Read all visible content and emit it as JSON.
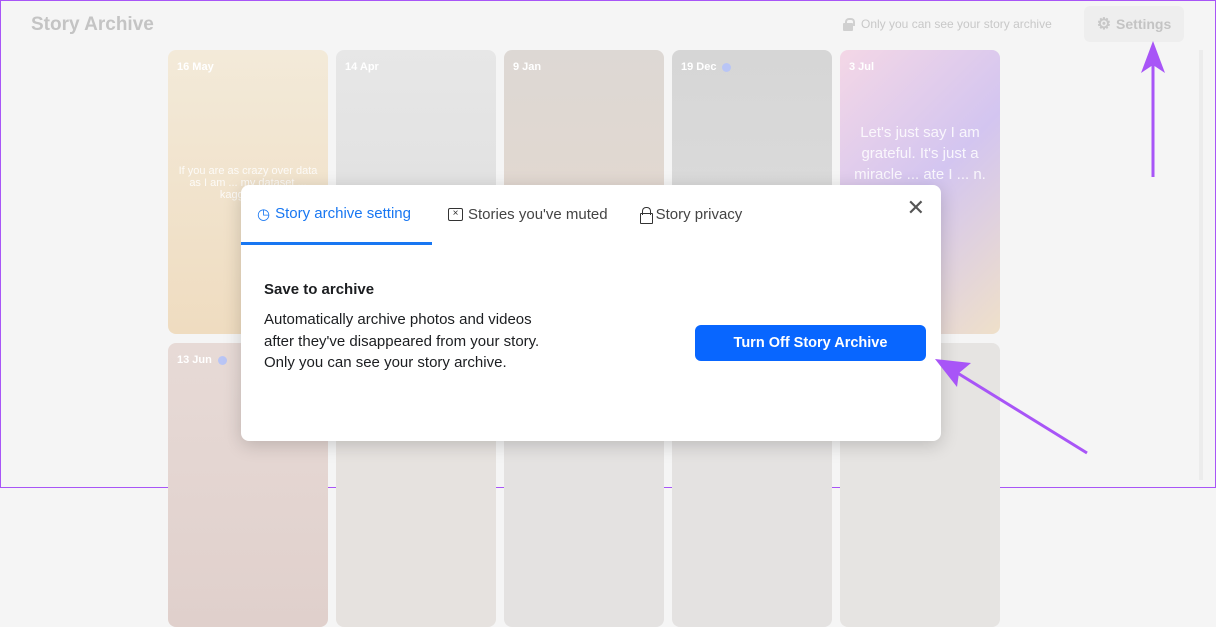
{
  "header": {
    "title": "Story Archive",
    "privacy_note": "Only you can see your story archive",
    "settings_label": "Settings"
  },
  "cards": [
    {
      "date": "16 May",
      "text": "If you are as crazy over data as I am ... my dataset ... kaggle.com",
      "bg": "linear-gradient(#f3ead9,#efdcc0)"
    },
    {
      "date": "14 Apr",
      "text": "",
      "bg": "linear-gradient(#e7e7e7,#dcdcdc)"
    },
    {
      "date": "9 Jan",
      "text": "",
      "bg": "linear-gradient(#ddd8d4,#e6d7cc)"
    },
    {
      "date": "19 Dec",
      "text": "",
      "bg": "linear-gradient(#d6d6d6,#dedede)"
    },
    {
      "date": "3 Jul",
      "text": "Let's just say I am grateful. It's just a miracle ... ate I ... n.",
      "bg": "linear-gradient(135deg,#f4d7e6,#d3c5f0,#efe0c9)"
    },
    {
      "date": "13 Jun",
      "text": "",
      "bg": "linear-gradient(#e7dad6,#e0d0cc)"
    },
    {
      "date": "",
      "text": "",
      "bg": "#e6e2df"
    },
    {
      "date": "",
      "text": "",
      "bg": "#e4e2e1"
    },
    {
      "date": "",
      "text": "",
      "bg": "#e4e2e1"
    },
    {
      "date": "",
      "text": "",
      "bg": "#e6e4e2"
    }
  ],
  "modal": {
    "tabs": [
      {
        "label": "Story archive setting",
        "active": true
      },
      {
        "label": "Stories you've muted"
      },
      {
        "label": "Story privacy"
      }
    ],
    "section_title": "Save to archive",
    "description": "Automatically archive photos and videos after they've disappeared from your story. Only you can see your story archive.",
    "button_label": "Turn Off Story Archive"
  },
  "colors": {
    "accent": "#0866ff",
    "annotation": "#a855f7"
  }
}
